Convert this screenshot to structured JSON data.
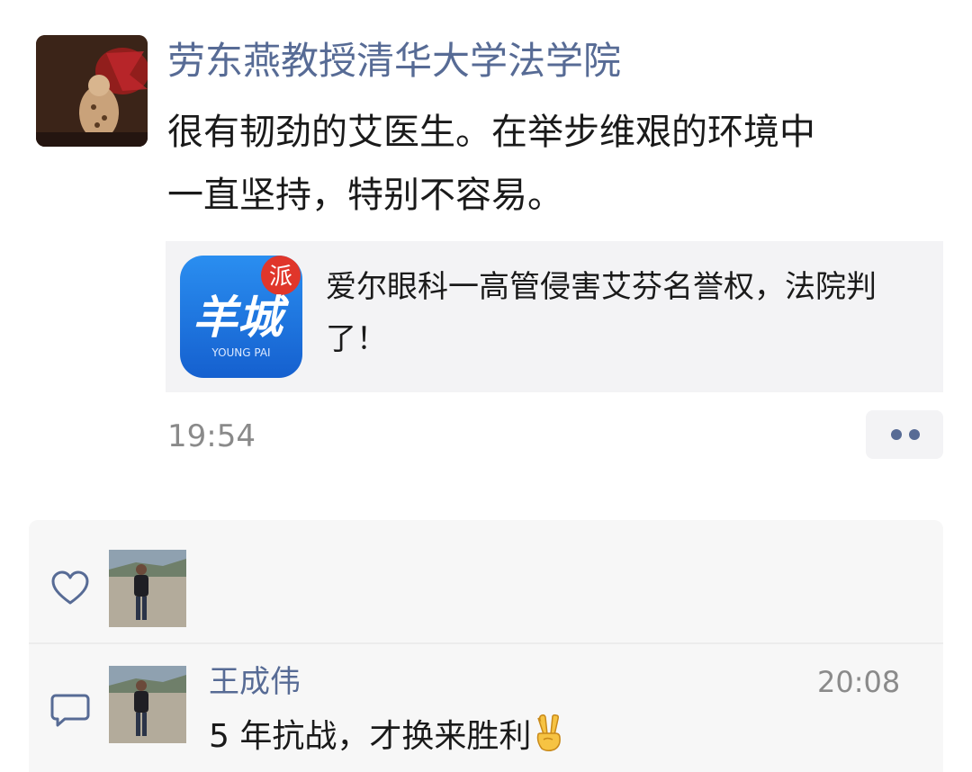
{
  "post": {
    "author": "劳东燕教授清华大学法学院",
    "text_lines": [
      "很有韧劲的艾医生。在举步维艰的环境中",
      "一直坚持，特别不容易。"
    ],
    "shared_link": {
      "thumbnail_text": "羊城",
      "thumbnail_badge": "派",
      "thumbnail_caption": "YOUNG PAI",
      "title_lines": [
        "爱尔眼科一高管侵害艾芬名誉权，法院判",
        "了！"
      ]
    },
    "time": "19:54",
    "more_icon": "two-dots-icon"
  },
  "interactions": {
    "like_icon": "heart-outline-icon",
    "comment_icon": "speech-bubble-icon",
    "comments": [
      {
        "author": "王成伟",
        "time": "20:08",
        "text": "5 年抗战，才换来胜利",
        "emoji": "victory-hand-icon"
      }
    ]
  },
  "colors": {
    "name_blue": "#576b95",
    "timestamp_gray": "#8a8a8a",
    "panel_bg": "#f7f7f7",
    "card_bg": "#f3f3f5",
    "app_icon_blue": "#1a73e8",
    "badge_red": "#e0362b"
  }
}
